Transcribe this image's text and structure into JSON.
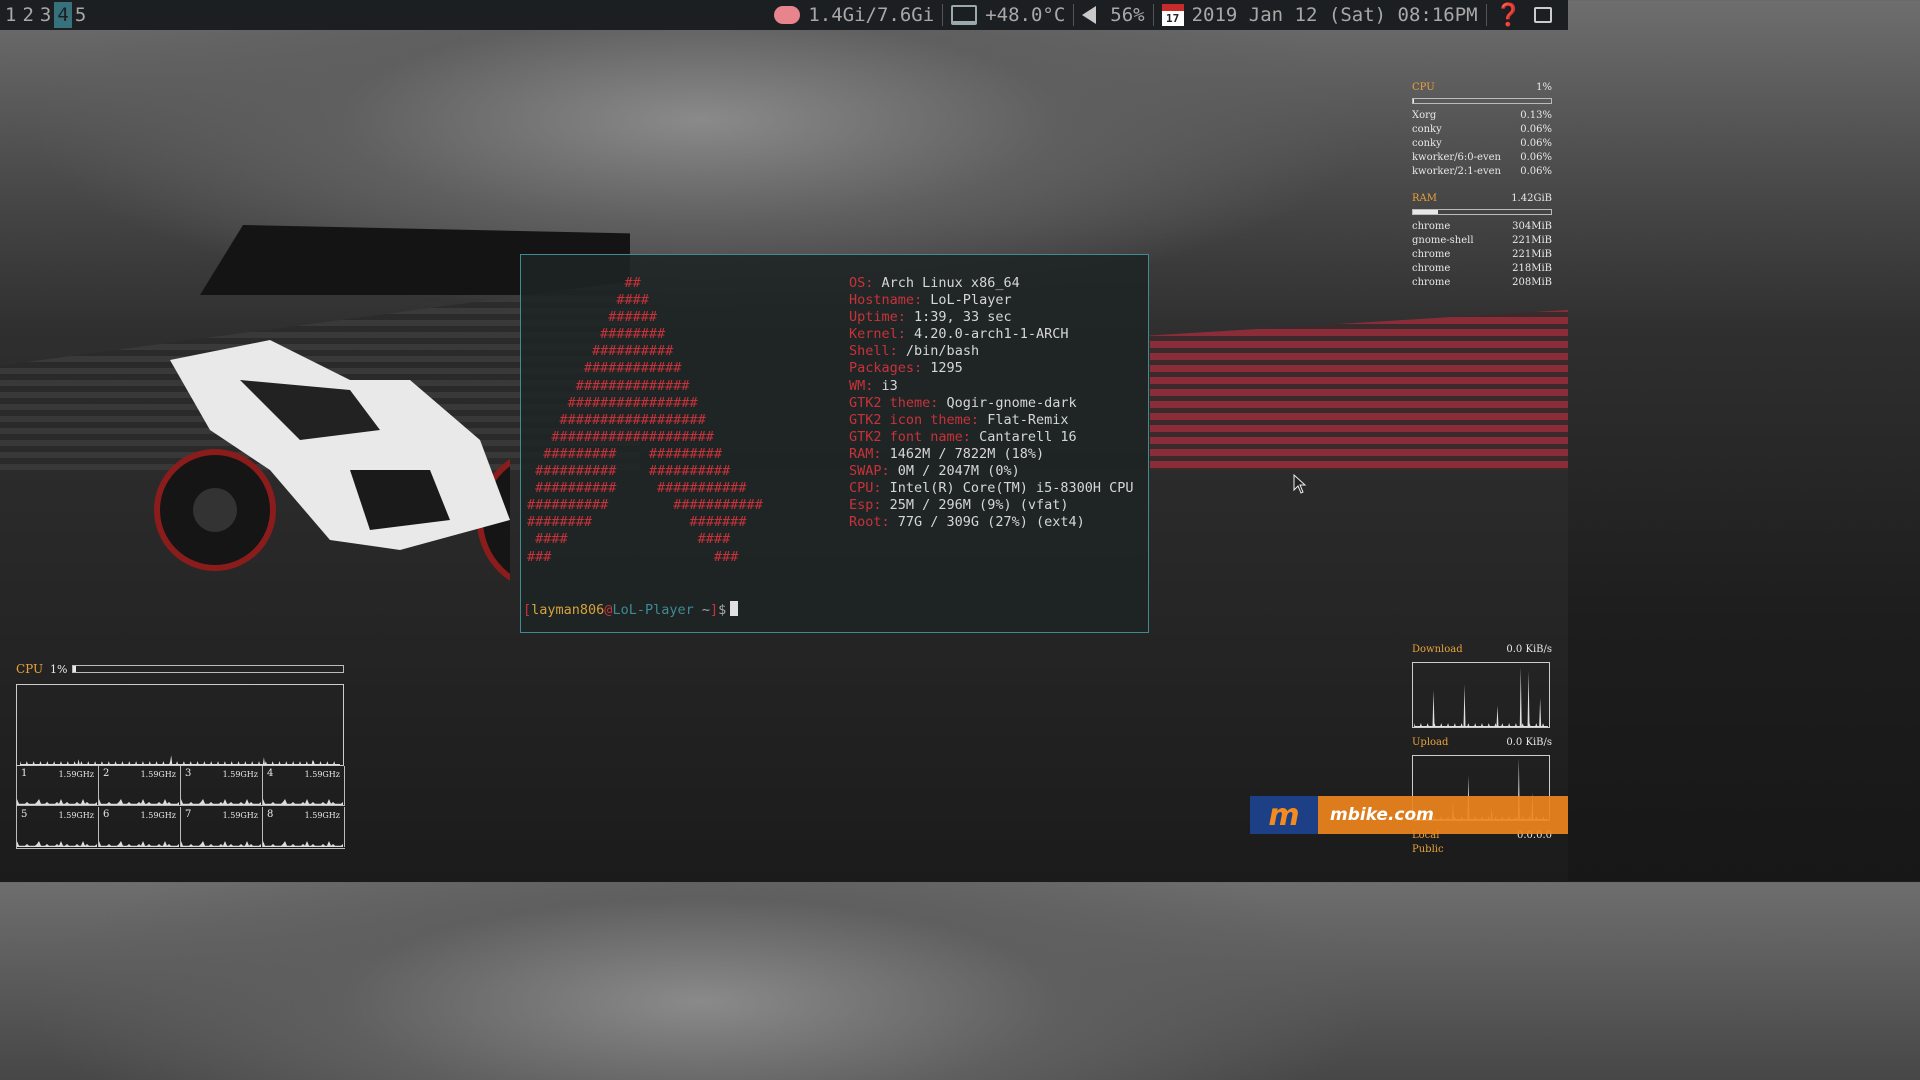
{
  "topbar": {
    "workspaces": [
      {
        "label": "1",
        "active": false
      },
      {
        "label": "2",
        "active": false
      },
      {
        "label": "3",
        "active": false
      },
      {
        "label": "4",
        "active": true
      },
      {
        "label": "5",
        "active": false
      }
    ],
    "memory": "1.4Gi/7.6Gi",
    "temperature": "+48.0°C",
    "volume": "56%",
    "calendar_day": "17",
    "datetime": "2019 Jan 12 (Sat) 08:16PM",
    "help_glyph": "❓",
    "icons": {
      "memory": "brain-icon",
      "temperature": "laptop-icon",
      "volume": "speaker-icon",
      "date": "calendar-icon",
      "help": "help-icon",
      "notifications": "message-icon"
    }
  },
  "terminal": {
    "ascii_art": [
      "            ##",
      "           ####",
      "          ######",
      "         ########",
      "        ##########",
      "       ############",
      "      ##############",
      "     ################",
      "    ##################",
      "   ####################",
      "  #########    #########",
      " ##########    ##########",
      " ##########     ###########",
      "##########        ###########",
      "########            #######",
      " ####                ####",
      "###                    ###"
    ],
    "info": [
      {
        "key": "OS:",
        "value": "Arch Linux x86_64"
      },
      {
        "key": "Hostname:",
        "value": "LoL-Player"
      },
      {
        "key": "Uptime:",
        "value": "1:39, 33 sec"
      },
      {
        "key": "Kernel:",
        "value": "4.20.0-arch1-1-ARCH"
      },
      {
        "key": "Shell:",
        "value": "/bin/bash"
      },
      {
        "key": "Packages:",
        "value": "1295"
      },
      {
        "key": "WM:",
        "value": "i3"
      },
      {
        "key": "GTK2 theme:",
        "value": "Qogir-gnome-dark"
      },
      {
        "key": "GTK2 icon theme:",
        "value": "Flat-Remix"
      },
      {
        "key": "GTK2 font name:",
        "value": "Cantarell 16"
      },
      {
        "key": "RAM:",
        "value": "1462M / 7822M (18%)"
      },
      {
        "key": "SWAP:",
        "value": "0M / 2047M (0%)"
      },
      {
        "key": "CPU:",
        "value": "Intel(R) Core(TM) i5-8300H CPU"
      },
      {
        "key": "Esp:",
        "value": "25M / 296M (9%) (vfat)"
      },
      {
        "key": "Root:",
        "value": "77G / 309G (27%) (ext4)"
      }
    ],
    "prompt": {
      "open": "[",
      "user": "layman806",
      "at": "@",
      "host": "LoL-Player",
      "dir": " ~",
      "close": "]",
      "symbol": "$"
    }
  },
  "conky_right": {
    "cpu": {
      "label": "CPU",
      "value": "1%",
      "fraction": 0.01
    },
    "processes": [
      {
        "name": "Xorg",
        "value": "0.13%"
      },
      {
        "name": "conky",
        "value": "0.06%"
      },
      {
        "name": "conky",
        "value": "0.06%"
      },
      {
        "name": "kworker/6:0-even",
        "value": "0.06%"
      },
      {
        "name": "kworker/2:1-even",
        "value": "0.06%"
      }
    ],
    "ram": {
      "label": "RAM",
      "value": "1.42GiB",
      "fraction": 0.18
    },
    "ram_processes": [
      {
        "name": "chrome",
        "value": "304MiB"
      },
      {
        "name": "gnome-shell",
        "value": "221MiB"
      },
      {
        "name": "chrome",
        "value": "221MiB"
      },
      {
        "name": "chrome",
        "value": "218MiB"
      },
      {
        "name": "chrome",
        "value": "208MiB"
      }
    ],
    "download": {
      "label": "Download",
      "value": "0.0 KiB/s"
    },
    "upload": {
      "label": "Upload",
      "value": "0.0 KiB/s"
    },
    "local": {
      "label": "Local",
      "value": "0.0.0.0"
    },
    "public": {
      "label": "Public"
    }
  },
  "conky_left": {
    "cpu_label": "CPU",
    "cpu_value": "1%",
    "cpu_fraction": 0.01,
    "cores": [
      {
        "n": "1",
        "freq": "1.59GHz"
      },
      {
        "n": "2",
        "freq": "1.59GHz"
      },
      {
        "n": "3",
        "freq": "1.59GHz"
      },
      {
        "n": "4",
        "freq": "1.59GHz"
      },
      {
        "n": "5",
        "freq": "1.59GHz"
      },
      {
        "n": "6",
        "freq": "1.59GHz"
      },
      {
        "n": "7",
        "freq": "1.59GHz"
      },
      {
        "n": "8",
        "freq": "1.59GHz"
      }
    ]
  },
  "watermark": {
    "logo": "m",
    "text": "mbike.com"
  },
  "colors": {
    "accent": "#37717c",
    "red": "#c8323a",
    "orange": "#e8a33a",
    "terminal_border": "#3f8a93"
  }
}
